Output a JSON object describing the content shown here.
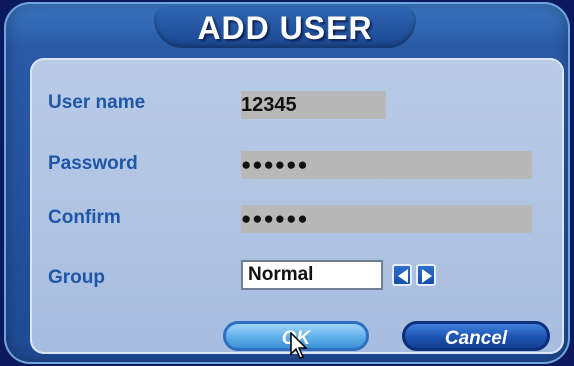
{
  "dialog": {
    "title": "ADD USER"
  },
  "form": {
    "username": {
      "label": "User name",
      "value": "12345"
    },
    "password": {
      "label": "Password",
      "value": "●●●●●●"
    },
    "confirm": {
      "label": "Confirm",
      "value": "●●●●●●"
    },
    "group": {
      "label": "Group",
      "value": "Normal"
    }
  },
  "buttons": {
    "ok_label": "OK",
    "cancel_label": "Cancel"
  },
  "colors": {
    "frame_blue": "#1f4a94",
    "panel_bg": "#a7bddf",
    "label_blue": "#1f57a8",
    "field_gray": "#b8b8b8"
  },
  "icons": [
    "left-arrow-icon",
    "right-arrow-icon",
    "mouse-cursor-icon"
  ]
}
